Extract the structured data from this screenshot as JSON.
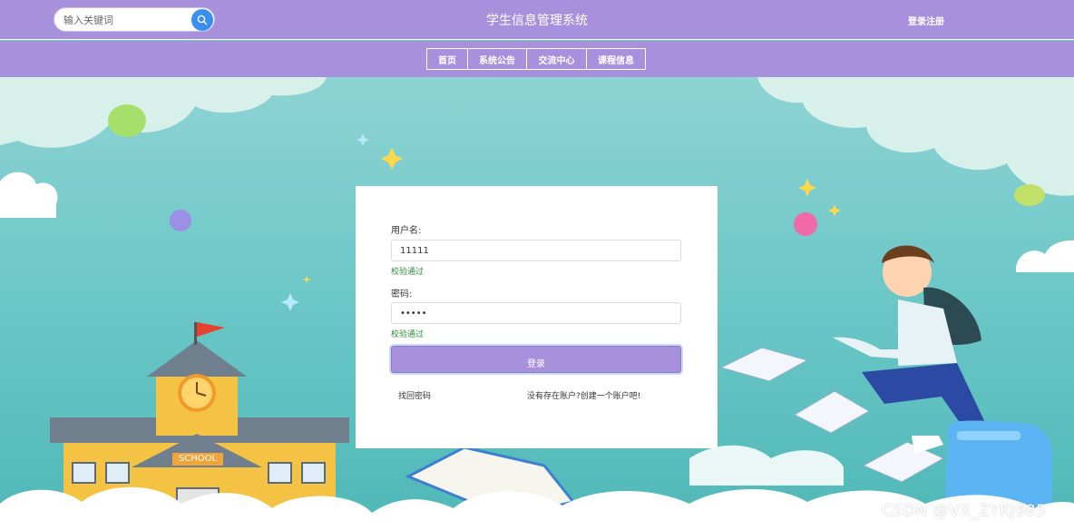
{
  "header": {
    "search_placeholder": "输入关键词",
    "search_icon": "search-icon",
    "title": "学生信息管理系统",
    "login_register": "登录注册"
  },
  "nav": {
    "items": [
      {
        "label": "首页"
      },
      {
        "label": "系统公告"
      },
      {
        "label": "交流中心"
      },
      {
        "label": "课程信息"
      }
    ]
  },
  "login_form": {
    "username_label": "用户名:",
    "username_value": "11111",
    "username_validation": "校验通过",
    "password_label": "密码:",
    "password_value": "11111",
    "password_validation": "校验通过",
    "login_button": "登录",
    "forgot_password": "找回密码",
    "register_prompt": "没有存在账户?创建一个账户吧!"
  },
  "scene": {
    "school_sign": "SCHOOL"
  },
  "watermark": "CSDN @VX_ZYKJ985",
  "colors": {
    "header_bg": "#a891dc",
    "search_button": "#3a8ef0",
    "valid_green": "#2e8b3d",
    "scene_teal": "#6ec8c8"
  }
}
